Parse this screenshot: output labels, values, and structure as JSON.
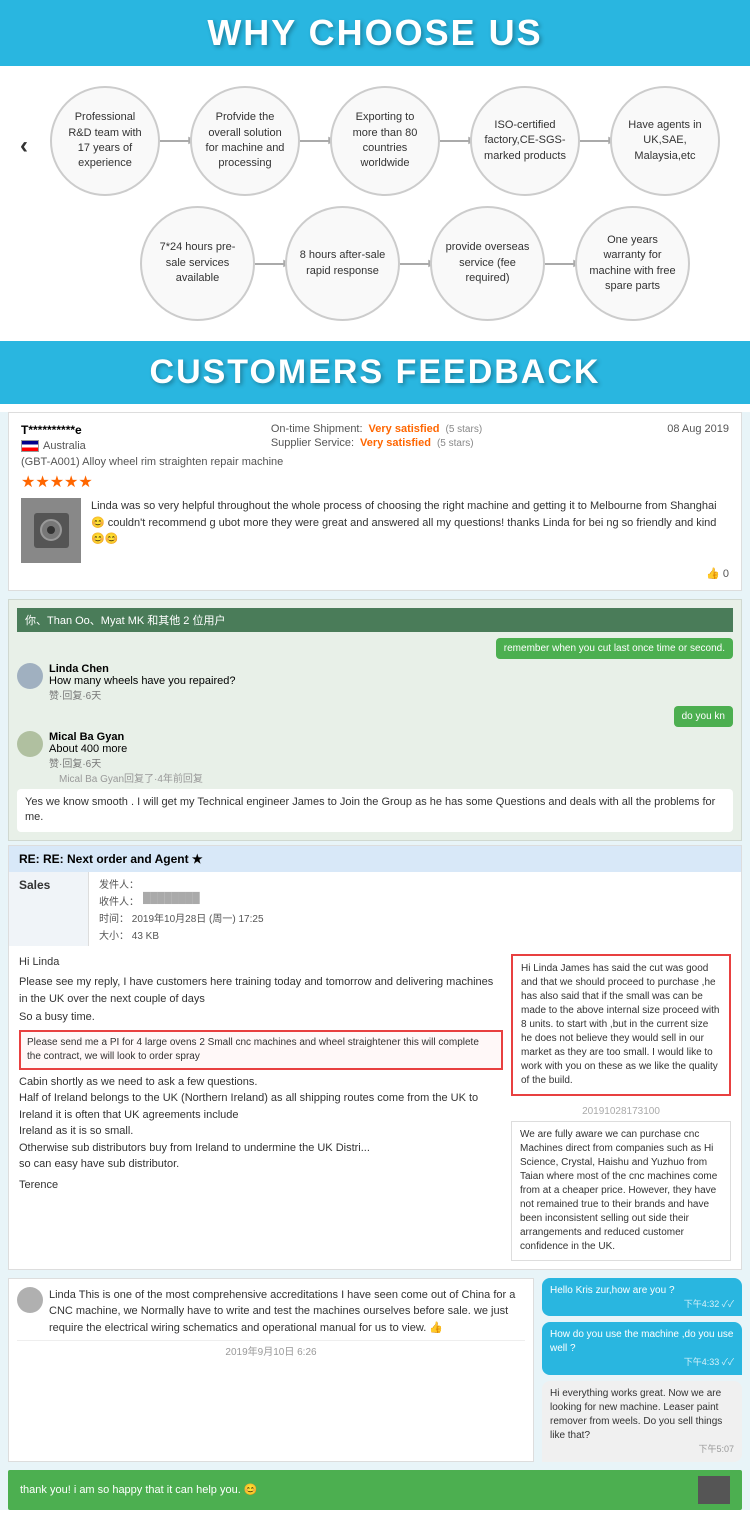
{
  "why_choose": {
    "header": "WHY CHOOSE US",
    "features_row1": [
      {
        "id": "rd-team",
        "text": "Professional R&D team with 17 years of experience"
      },
      {
        "id": "overall-solution",
        "text": "Profvide the overall solution for machine and processing"
      },
      {
        "id": "exporting",
        "text": "Exporting to more than 80 countries worldwide"
      },
      {
        "id": "iso-certified",
        "text": "ISO-certified factory,CE-SGS-marked products"
      },
      {
        "id": "agents",
        "text": "Have agents in UK,SAE, Malaysia,etc"
      }
    ],
    "features_row2": [
      {
        "id": "pre-sale",
        "text": "7*24 hours pre-sale services available"
      },
      {
        "id": "after-sale",
        "text": "8 hours after-sale rapid response"
      },
      {
        "id": "overseas",
        "text": "provide overseas service (fee required)"
      },
      {
        "id": "warranty",
        "text": "One years warranty for machine with free spare parts"
      }
    ]
  },
  "customers_feedback": {
    "header": "CUSTOMERS FEEDBACK",
    "review": {
      "reviewer_name": "T**********e",
      "country": "Australia",
      "on_time_label": "On-time Shipment:",
      "on_time_value": "Very satisfied",
      "on_time_stars": "(5 stars)",
      "supplier_label": "Supplier Service:",
      "supplier_value": "Very satisfied",
      "supplier_stars": "(5 stars)",
      "date": "08 Aug 2019",
      "product_name": "(GBT-A001) Alloy wheel rim straighten repair machine",
      "stars": "★★★★★",
      "review_text": "Linda was so very helpful throughout the whole process of choosing the right machine and getting it to Melbourne from Shanghai 😊 couldn't recommend g ubot more they were great and answered all my questions! thanks Linda for bei ng so friendly and kind 😊😊",
      "helpful_count": "0"
    },
    "chat1": {
      "participants": "你、Than Oo、Myat MK 和其他 2 位用户",
      "message1_sender": "Linda Chen",
      "message1_text": "How many wheels have you repaired?",
      "message1_meta": "赞·回复·6天",
      "message2_sender": "Mical Ba Gyan",
      "message2_text": "About 400 more",
      "message2_meta": "赞·回复·6天",
      "message2_reply": "Mical Ba Gyan回复了·4年前回复",
      "right_bubble1": "remember when you cut last once time or second.",
      "right_bubble2": "do you kn",
      "tech_message": "Yes we know smooth . I will get my Technical engineer James to Join the Group as he has some Questions and deals with all the problems for me."
    },
    "email": {
      "subject": "RE: RE: Next order and Agent ★",
      "sales_label": "Sales",
      "from_label": "发件人：",
      "from_value": "",
      "to_label": "收件人：",
      "to_value": "",
      "date_label": "时间：",
      "date_value": "2019年10月28日 (周一) 17:25",
      "size_label": "大小：",
      "size_value": "43 KB",
      "greeting": "Hi Linda",
      "body1": "Please see my reply, I have customers here training today and tomorrow and delivering machines in the UK over the next couple of days",
      "body2": "So a busy time.",
      "highlighted_text": "Please send me a PI for 4 large ovens 2 Small cnc machines and wheel straightener this will complete the contract, we will look to order spray",
      "body3": "Cabin shortly as we need to ask a few questions.",
      "body4": "Half of Ireland belongs to the UK (Northern Ireland) as all shipping routes come from the UK to Ireland it is often that UK agreements include",
      "body5": "Ireland as it is so small.",
      "body6": "Otherwise sub distributors buy from Ireland to undermine the UK Distri...",
      "body7": "so can easy have sub distributor.",
      "signature": "Terence",
      "email_highlighted_box": "Hi Linda James has said the cut was good and that we should proceed to purchase ,he has also said that if the small was can be made to the above internal size proceed with 8 units. to start with ,but in the current size he does not believe they would sell in our market as they are too small. I would like to work with you on these as we like the quality of the build.",
      "date_divider": "20191028173100",
      "message_box2": "We are fully aware we can purchase cnc Machines direct from companies such as Hi Science, Crystal, Haishu and Yuzhuo from Taian where most of the cnc machines come from at a cheaper price.\nHowever, they have not remained true to their brands and have been inconsistent selling out side their arrangements and reduced customer confidence in the UK."
    },
    "bottom_left": {
      "text1": "Linda This is one of the most comprehensive accreditations I have seen come out of China for a CNC machine, we Normally have to write and test the machines ourselves before sale.  we just require the electrical wiring schematics and operational manual for us to view. 👍",
      "date_stamp": "2019年9月10日 6:26"
    },
    "bottom_right": {
      "bubble1_text": "Hello Kris zur,how are you ?",
      "bubble1_time": "下午4:32 ✓✓",
      "bubble2_text": "How do you use the machine ,do you use well ?",
      "bubble2_time": "下午4:33 ✓✓",
      "bubble3_text": "Hi everything works great. Now we are looking for new machine. Leaser paint remover from weels. Do you sell things like that?",
      "bubble3_time": "下午5:07"
    },
    "green_bubble": "thank you! i am so happy that it can help you. 😊"
  }
}
